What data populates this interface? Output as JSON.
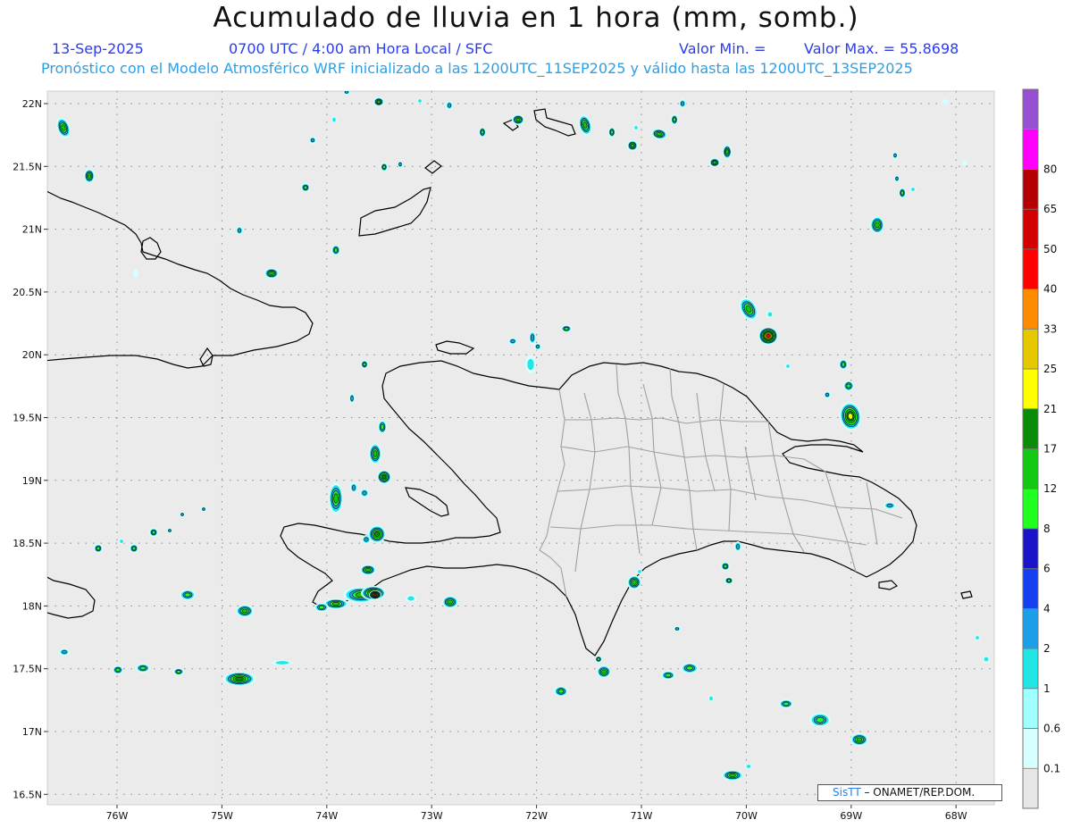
{
  "header": {
    "title": "Acumulado de lluvia en 1 hora (mm, somb.)",
    "date": "13-Sep-2025",
    "time_info": "0700 UTC / 4:00 am Hora Local / SFC",
    "min_label": "Valor Min. =",
    "max_label": "Valor Max. = 55.8698",
    "model_info": "Pronóstico con el Modelo Atmosférico WRF inicializado a las 1200UTC_11SEP2025 y válido hasta las  1200UTC_13SEP2025"
  },
  "axes": {
    "lon_labels": [
      "76W",
      "75W",
      "74W",
      "73W",
      "72W",
      "71W",
      "70W",
      "69W",
      "68W"
    ],
    "lat_labels": [
      "22N",
      "21.5N",
      "21N",
      "20.5N",
      "20N",
      "19.5N",
      "19N",
      "18.5N",
      "18N",
      "17.5N",
      "17N",
      "16.5N"
    ]
  },
  "colorbar": {
    "labels": [
      "0.1",
      "0.6",
      "1",
      "2",
      "4",
      "6",
      "8",
      "12",
      "17",
      "21",
      "25",
      "33",
      "40",
      "50",
      "65",
      "80"
    ],
    "colors": [
      "#e6e6e6",
      "#d8ffff",
      "#a0ffff",
      "#22e6e6",
      "#1e9ee8",
      "#1440f0",
      "#1a14c8",
      "#20ff20",
      "#12c812",
      "#0a8c0a",
      "#ffff00",
      "#e6c800",
      "#ff8c00",
      "#ff0000",
      "#d20000",
      "#b40000",
      "#ff00ff",
      "#9650d2"
    ]
  },
  "credit": {
    "brand": "SisTT",
    "text": "– ONAMET/REP.DOM."
  },
  "colors": {
    "background": "#ebebeb",
    "coast": "#000000",
    "borders": "#a0a0a0",
    "grid": "#888888"
  }
}
